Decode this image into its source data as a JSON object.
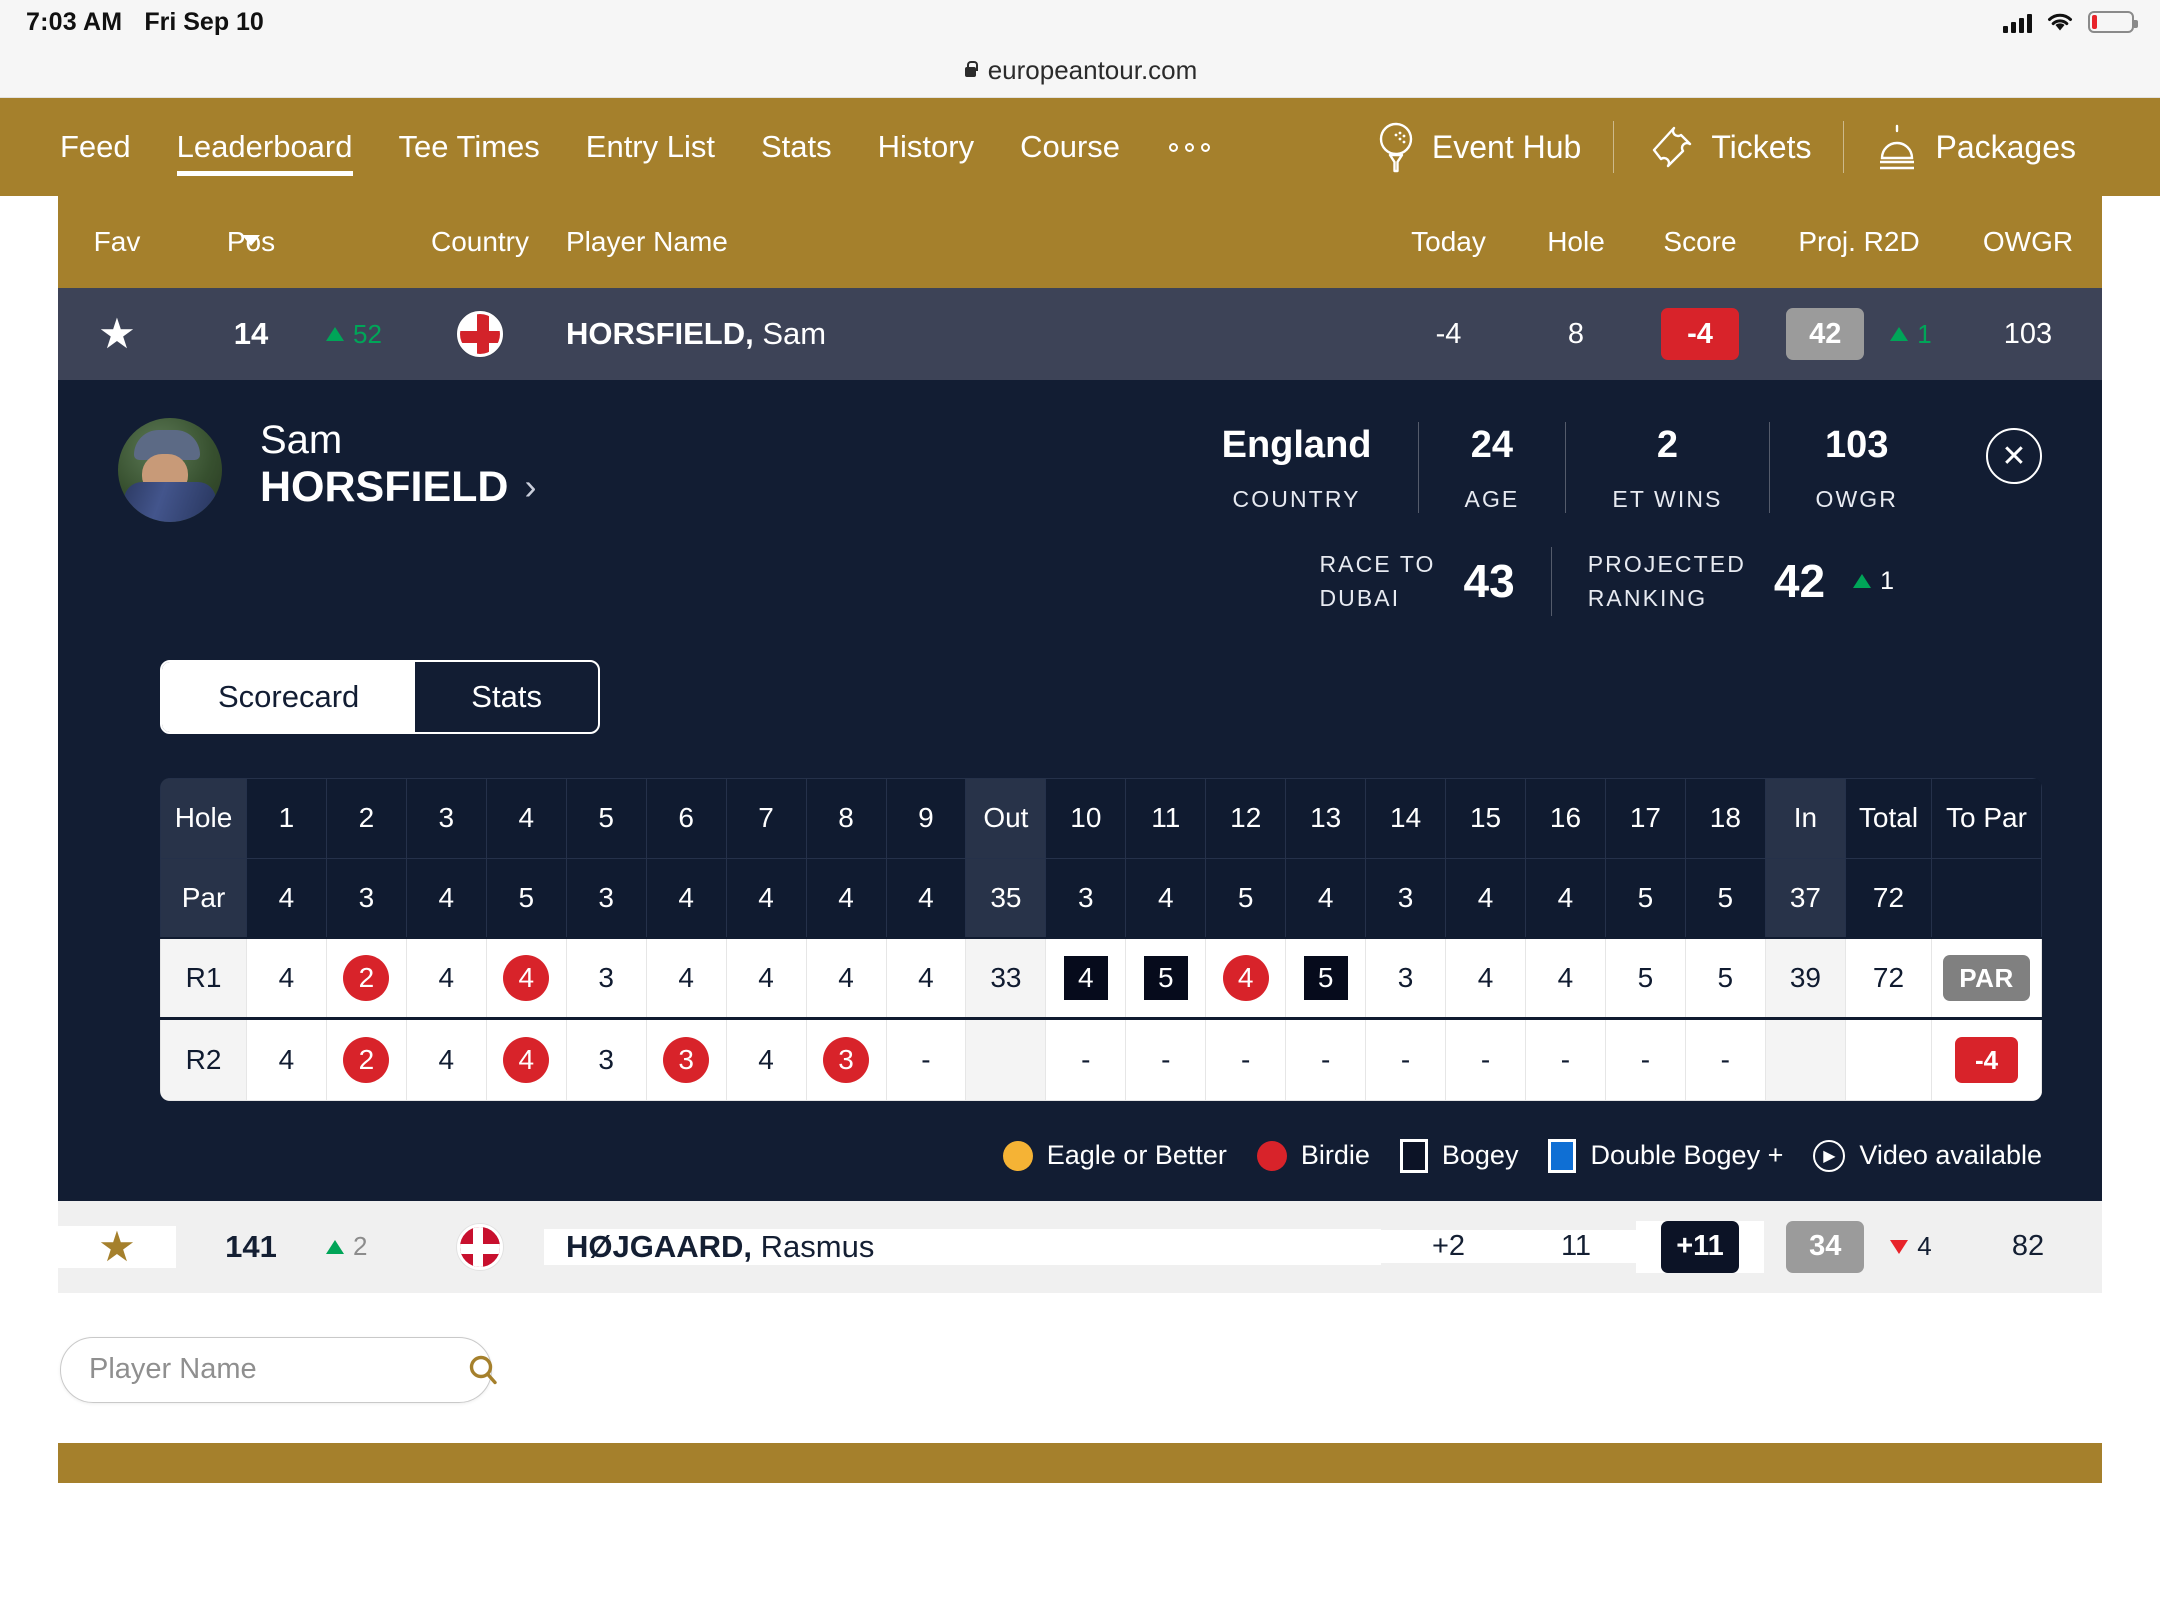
{
  "status_bar": {
    "time": "7:03 AM",
    "date": "Fri Sep 10",
    "signal_icon": "cellular-bars-icon",
    "wifi_icon": "wifi-icon",
    "battery_icon": "battery-low-icon"
  },
  "browser": {
    "lock_icon": "lock-icon",
    "url": "europeantour.com"
  },
  "nav": {
    "items": [
      {
        "label": "Feed",
        "active": false
      },
      {
        "label": "Leaderboard",
        "active": true
      },
      {
        "label": "Tee Times",
        "active": false
      },
      {
        "label": "Entry List",
        "active": false
      },
      {
        "label": "Stats",
        "active": false
      },
      {
        "label": "History",
        "active": false
      },
      {
        "label": "Course",
        "active": false
      }
    ],
    "overflow_icon": "more-dots-icon",
    "links": [
      {
        "label": "Event Hub",
        "icon": "golf-ball-tee-icon"
      },
      {
        "label": "Tickets",
        "icon": "ticket-icon"
      },
      {
        "label": "Packages",
        "icon": "bell-service-icon"
      }
    ],
    "accent_gold": "#a5802c"
  },
  "leaderboard": {
    "columns": {
      "fav": "Fav",
      "pos": "Pos",
      "country": "Country",
      "player_name": "Player Name",
      "today": "Today",
      "hole": "Hole",
      "score": "Score",
      "proj_r2d": "Proj. R2D",
      "owgr": "OWGR"
    },
    "sort_icon": "sort-descending-caret",
    "rows": [
      {
        "fav_icon": "star-filled-icon",
        "pos": "14",
        "movement_direction": "up",
        "movement_value": "52",
        "country_flag": "flag-england",
        "last_name": "HORSFIELD,",
        "first_name": "Sam",
        "today": "-4",
        "hole": "8",
        "score": "-4",
        "score_style": "red",
        "proj_r2d": "42",
        "proj_delta_direction": "up",
        "proj_delta_value": "1",
        "owgr": "103",
        "selected": true
      },
      {
        "fav_icon": "star-filled-icon",
        "pos": "141",
        "movement_direction": "up",
        "movement_value": "2",
        "country_flag": "flag-denmark",
        "last_name": "HØJGAARD,",
        "first_name": "Rasmus",
        "today": "+2",
        "hole": "11",
        "score": "+11",
        "score_style": "dark",
        "proj_r2d": "34",
        "proj_delta_direction": "down",
        "proj_delta_value": "4",
        "owgr": "82",
        "selected": false
      }
    ]
  },
  "player_panel": {
    "avatar_icon": "player-headshot-avatar",
    "first_name": "Sam",
    "last_name": "HORSFIELD",
    "profile_chevron": "chevron-right-icon",
    "close_icon": "close-x-icon",
    "stats": [
      {
        "value": "England",
        "label": "COUNTRY"
      },
      {
        "value": "24",
        "label": "AGE"
      },
      {
        "value": "2",
        "label": "ET WINS"
      },
      {
        "value": "103",
        "label": "OWGR"
      }
    ],
    "rankings": [
      {
        "label_line1": "RACE TO",
        "label_line2": "DUBAI",
        "value": "43",
        "delta_direction": "",
        "delta_value": ""
      },
      {
        "label_line1": "PROJECTED",
        "label_line2": "RANKING",
        "value": "42",
        "delta_direction": "up",
        "delta_value": "1"
      }
    ],
    "tabs": [
      {
        "label": "Scorecard",
        "active": true
      },
      {
        "label": "Stats",
        "active": false
      }
    ]
  },
  "scorecard": {
    "row_labels": {
      "hole": "Hole",
      "par": "Par",
      "r1": "R1",
      "r2": "R2"
    },
    "headers": [
      "1",
      "2",
      "3",
      "4",
      "5",
      "6",
      "7",
      "8",
      "9",
      "Out",
      "10",
      "11",
      "12",
      "13",
      "14",
      "15",
      "16",
      "17",
      "18",
      "In",
      "Total",
      "To Par"
    ],
    "par": [
      "4",
      "3",
      "4",
      "5",
      "3",
      "4",
      "4",
      "4",
      "4",
      "35",
      "3",
      "4",
      "5",
      "4",
      "3",
      "4",
      "4",
      "5",
      "5",
      "37",
      "72",
      ""
    ],
    "r1": [
      {
        "v": "4",
        "m": "none"
      },
      {
        "v": "2",
        "m": "birdie"
      },
      {
        "v": "4",
        "m": "none"
      },
      {
        "v": "4",
        "m": "birdie"
      },
      {
        "v": "3",
        "m": "none"
      },
      {
        "v": "4",
        "m": "none"
      },
      {
        "v": "4",
        "m": "none"
      },
      {
        "v": "4",
        "m": "none"
      },
      {
        "v": "4",
        "m": "none"
      },
      {
        "v": "33",
        "m": "sum"
      },
      {
        "v": "4",
        "m": "bogey"
      },
      {
        "v": "5",
        "m": "bogey"
      },
      {
        "v": "4",
        "m": "birdie"
      },
      {
        "v": "5",
        "m": "bogey"
      },
      {
        "v": "3",
        "m": "none"
      },
      {
        "v": "4",
        "m": "none"
      },
      {
        "v": "4",
        "m": "none"
      },
      {
        "v": "5",
        "m": "none"
      },
      {
        "v": "5",
        "m": "none"
      },
      {
        "v": "39",
        "m": "sum"
      },
      {
        "v": "72",
        "m": "none"
      },
      {
        "v": "PAR",
        "m": "par-pill"
      }
    ],
    "r2": [
      {
        "v": "4",
        "m": "none"
      },
      {
        "v": "2",
        "m": "birdie"
      },
      {
        "v": "4",
        "m": "none"
      },
      {
        "v": "4",
        "m": "birdie"
      },
      {
        "v": "3",
        "m": "none"
      },
      {
        "v": "3",
        "m": "birdie"
      },
      {
        "v": "4",
        "m": "none"
      },
      {
        "v": "3",
        "m": "birdie"
      },
      {
        "v": "-",
        "m": "none"
      },
      {
        "v": "",
        "m": "sum"
      },
      {
        "v": "-",
        "m": "none"
      },
      {
        "v": "-",
        "m": "none"
      },
      {
        "v": "-",
        "m": "none"
      },
      {
        "v": "-",
        "m": "none"
      },
      {
        "v": "-",
        "m": "none"
      },
      {
        "v": "-",
        "m": "none"
      },
      {
        "v": "-",
        "m": "none"
      },
      {
        "v": "-",
        "m": "none"
      },
      {
        "v": "-",
        "m": "none"
      },
      {
        "v": "",
        "m": "sum"
      },
      {
        "v": "",
        "m": "none"
      },
      {
        "v": "-4",
        "m": "red-pill"
      }
    ],
    "legend": [
      {
        "label": "Eagle or Better",
        "marker": "eagle-dot-icon",
        "color": "#f5b335"
      },
      {
        "label": "Birdie",
        "marker": "birdie-dot-icon",
        "color": "#d8232a"
      },
      {
        "label": "Bogey",
        "marker": "bogey-square-icon",
        "color": "#0c1326"
      },
      {
        "label": "Double Bogey +",
        "marker": "double-bogey-square-icon",
        "color": "#0f6fd4"
      },
      {
        "label": "Video available",
        "marker": "play-circle-icon",
        "color": "#ffffff"
      }
    ]
  },
  "search": {
    "placeholder": "Player Name",
    "value": "",
    "icon": "search-icon"
  }
}
